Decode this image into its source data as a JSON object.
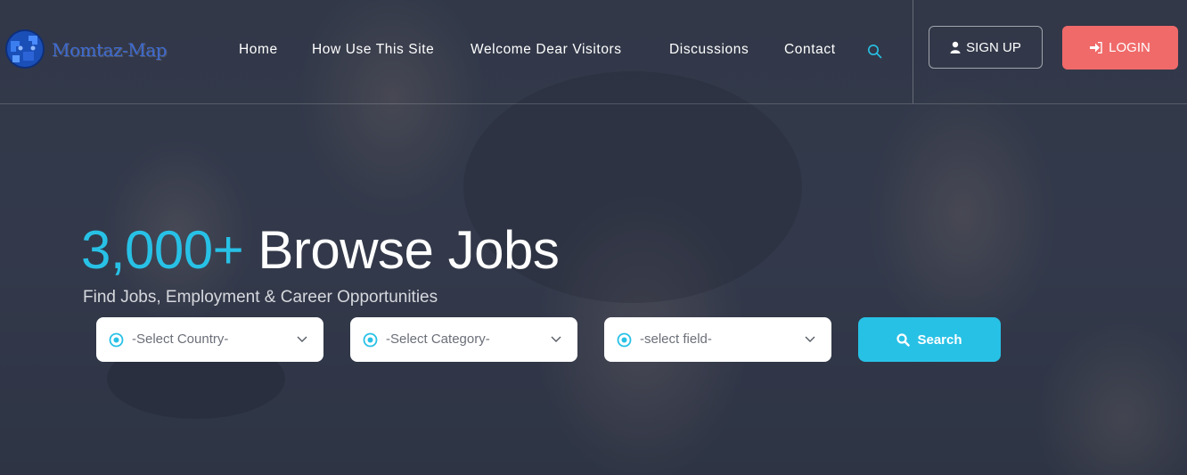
{
  "brand": {
    "name": "Momtaz-Map"
  },
  "nav": {
    "items": [
      {
        "label": "Home"
      },
      {
        "label": "How Use This Site"
      },
      {
        "label": "Welcome Dear Visitors"
      },
      {
        "label": "Discussions"
      },
      {
        "label": "Contact"
      }
    ],
    "search_icon": "search-icon"
  },
  "auth": {
    "signup_label": "SIGN UP",
    "signup_icon": "user-icon",
    "login_label": "LOGIN",
    "login_icon": "sign-in-icon"
  },
  "hero": {
    "count": "3,000+",
    "title": "Browse Jobs",
    "subtitle": "Find Jobs, Employment & Career Opportunities"
  },
  "filters": {
    "country": {
      "value": "-Select Country-"
    },
    "category": {
      "value": "-Select Category-"
    },
    "field": {
      "value": "-select field-"
    }
  },
  "search_button": {
    "label": "Search",
    "icon": "search-icon"
  },
  "colors": {
    "accent": "#28c1e6",
    "login": "#f06a6a",
    "brand_text": "#3e6ad0"
  }
}
